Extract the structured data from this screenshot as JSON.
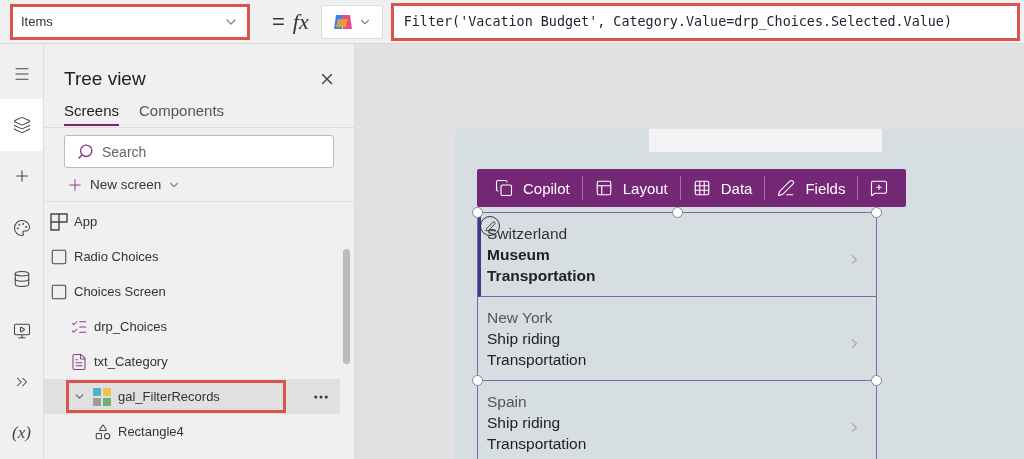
{
  "property_dropdown": {
    "value": "Items"
  },
  "formula_bar": {
    "equals": "=",
    "fx": "fx",
    "formula": "Filter('Vacation Budget', Category.Value=drp_Choices.Selected.Value)"
  },
  "rail": [
    {
      "kind": "menu",
      "selected": false
    },
    {
      "kind": "layers",
      "selected": true
    },
    {
      "kind": "insert",
      "selected": false
    },
    {
      "kind": "theme",
      "selected": false
    },
    {
      "kind": "data",
      "selected": false
    },
    {
      "kind": "media",
      "selected": false
    },
    {
      "kind": "flows",
      "selected": false
    },
    {
      "kind": "variables",
      "selected": false,
      "label": "(x)"
    }
  ],
  "tree_view": {
    "title": "Tree view",
    "tabs": [
      {
        "label": "Screens",
        "selected": true
      },
      {
        "label": "Components",
        "selected": false
      }
    ],
    "search": {
      "placeholder": "Search"
    },
    "new_screen": "New screen",
    "items": [
      {
        "kind": "app",
        "label": "App",
        "selected": false
      },
      {
        "kind": "screen",
        "label": "Radio Choices",
        "selected": false
      },
      {
        "kind": "screen",
        "label": "Choices Screen",
        "selected": false,
        "children": [
          {
            "kind": "dropdown",
            "label": "drp_Choices",
            "selected": false
          },
          {
            "kind": "text",
            "label": "txt_Category",
            "selected": false
          },
          {
            "kind": "gallery",
            "label": "gal_FilterRecords",
            "selected": true,
            "expanded": true,
            "children": [
              {
                "kind": "rectangle",
                "label": "Rectangle4",
                "selected": false
              }
            ]
          }
        ]
      }
    ]
  },
  "canvas": {
    "toolbar": [
      {
        "kind": "copilot",
        "label": "Copilot"
      },
      {
        "kind": "layout",
        "label": "Layout"
      },
      {
        "kind": "data",
        "label": "Data"
      },
      {
        "kind": "fields",
        "label": "Fields"
      },
      {
        "kind": "comment"
      }
    ],
    "gallery": [
      {
        "title": "Switzerland",
        "subtitle": "Museum",
        "category": "Transportation",
        "selected": true
      },
      {
        "title": "New York",
        "subtitle": "Ship riding",
        "category": "Transportation",
        "selected": false
      },
      {
        "title": "Spain",
        "subtitle": "Ship riding",
        "category": "Transportation",
        "selected": false
      }
    ]
  }
}
